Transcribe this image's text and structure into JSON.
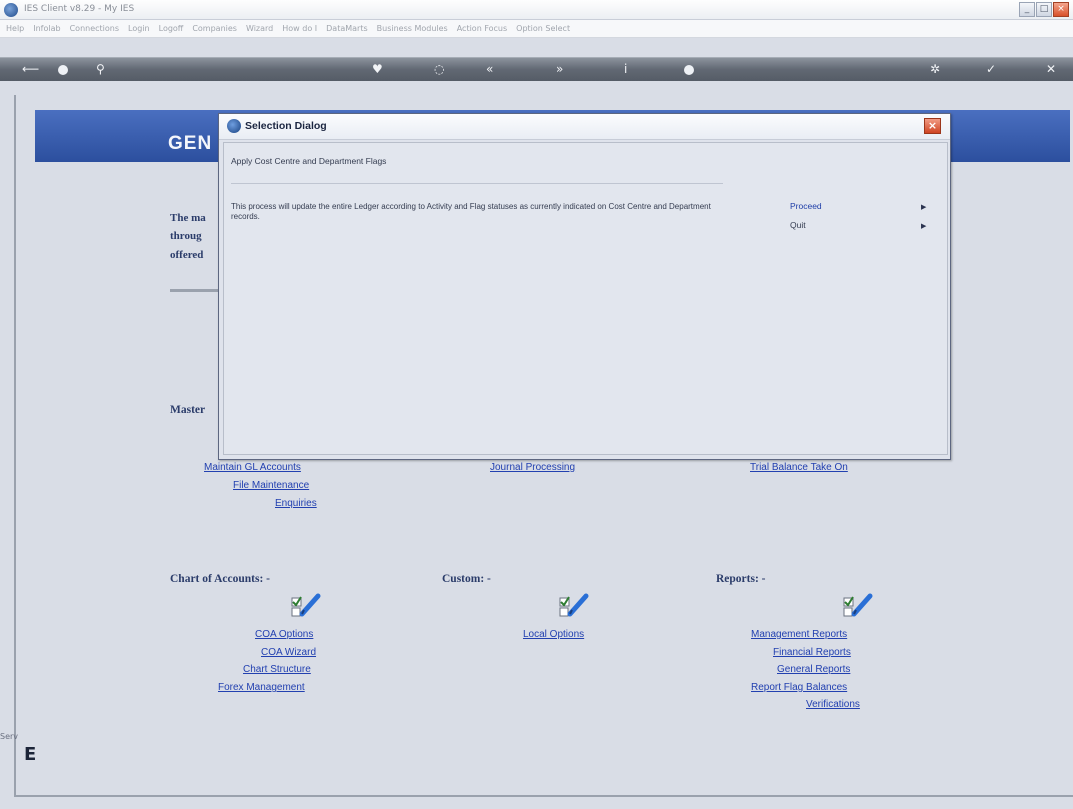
{
  "window": {
    "title": "IES Client v8.29 - My IES"
  },
  "menubar": {
    "items": [
      "Help",
      "Infolab",
      "Connections",
      "Login",
      "Logoff",
      "Companies",
      "Wizard",
      "How do I",
      "DataMarts",
      "Business Modules",
      "Action Focus",
      "Option Select"
    ]
  },
  "banner": {
    "text": "GEN"
  },
  "intro": {
    "line1": "The ma",
    "line2": "throug",
    "line3": "offered"
  },
  "sections": {
    "master_title": "Master",
    "master_links": [
      "Maintain GL Accounts",
      "File Maintenance",
      "Enquiries"
    ],
    "journal_link": "Journal Processing",
    "trial_link": "Trial Balance Take On",
    "chart_title": "Chart of Accounts: -",
    "chart_links": [
      "COA Options",
      "COA Wizard",
      "Chart Structure",
      "Forex Management"
    ],
    "custom_title": "Custom: -",
    "custom_links": [
      "Local Options"
    ],
    "reports_title": "Reports: -",
    "reports_links": [
      "Management Reports",
      "Financial Reports",
      "General Reports",
      "Report Flag Balances",
      "Verifications"
    ]
  },
  "side": {
    "fragment": "Serv",
    "bottom_letter": "E"
  },
  "dialog": {
    "title": "Selection Dialog",
    "subtitle": "Apply Cost Centre and Department Flags",
    "description": "This process will update the entire Ledger according to Activity and Flag statuses as currently indicated on Cost Centre and Department records.",
    "actions": {
      "proceed": "Proceed",
      "quit": "Quit"
    }
  },
  "colors": {
    "banner": "#2c4f9e",
    "link": "#2240b0",
    "toolbar": "#616873"
  }
}
